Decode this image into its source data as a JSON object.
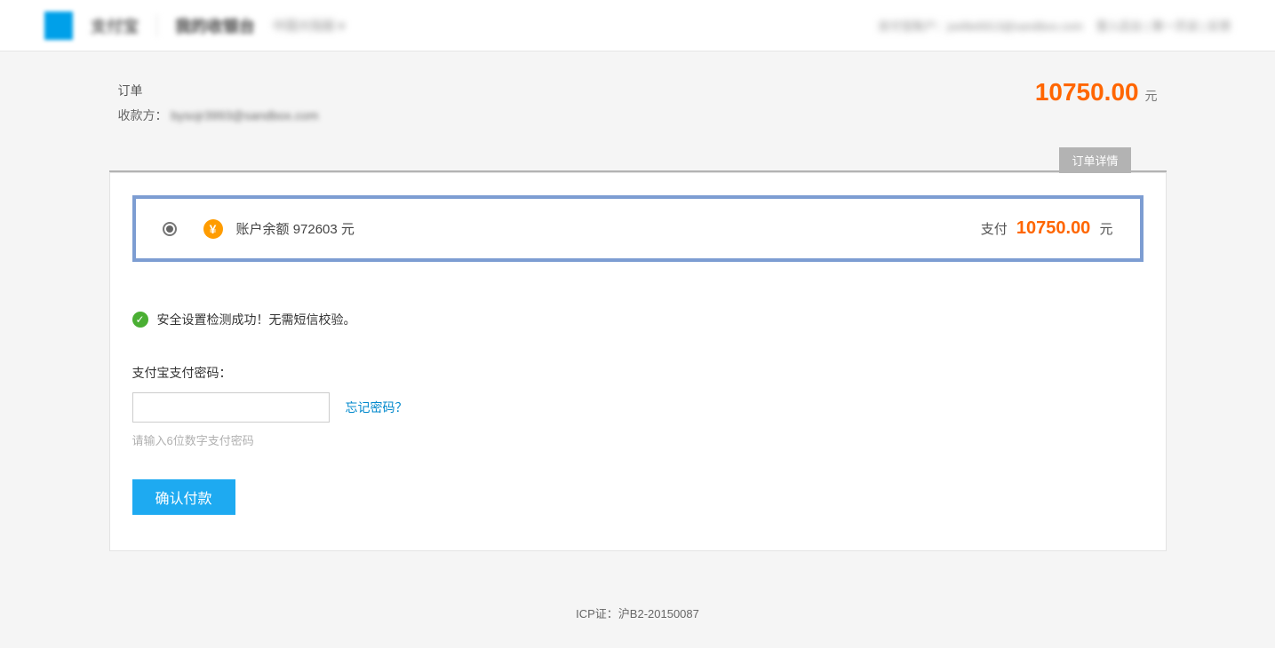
{
  "header": {
    "logoText": "支付宝",
    "siteTitle": "我的收银台",
    "region": "中国大陆版 ▾",
    "accountLabel": "支付宝账户：joellie6913@sandbox.com",
    "navLinks": "登入后台  |  第一页谈  |  反馈"
  },
  "order": {
    "title": "订单",
    "payeeLabel": "收款方：",
    "payeeEmail": "bysojr3993@sandbox.com",
    "totalAmount": "10750.00",
    "currencyUnit": "元"
  },
  "detailTab": "订单详情",
  "balance": {
    "label": "账户余额",
    "amount": "972603",
    "unit": "元",
    "payLabel": "支付",
    "payAmount": "10750.00",
    "payUnit": "元"
  },
  "security": {
    "text": "安全设置检测成功！无需短信校验。"
  },
  "password": {
    "label": "支付宝支付密码：",
    "forgot": "忘记密码？",
    "hint": "请输入6位数字支付密码"
  },
  "confirmButton": "确认付款",
  "footer": "ICP证：沪B2-20150087"
}
